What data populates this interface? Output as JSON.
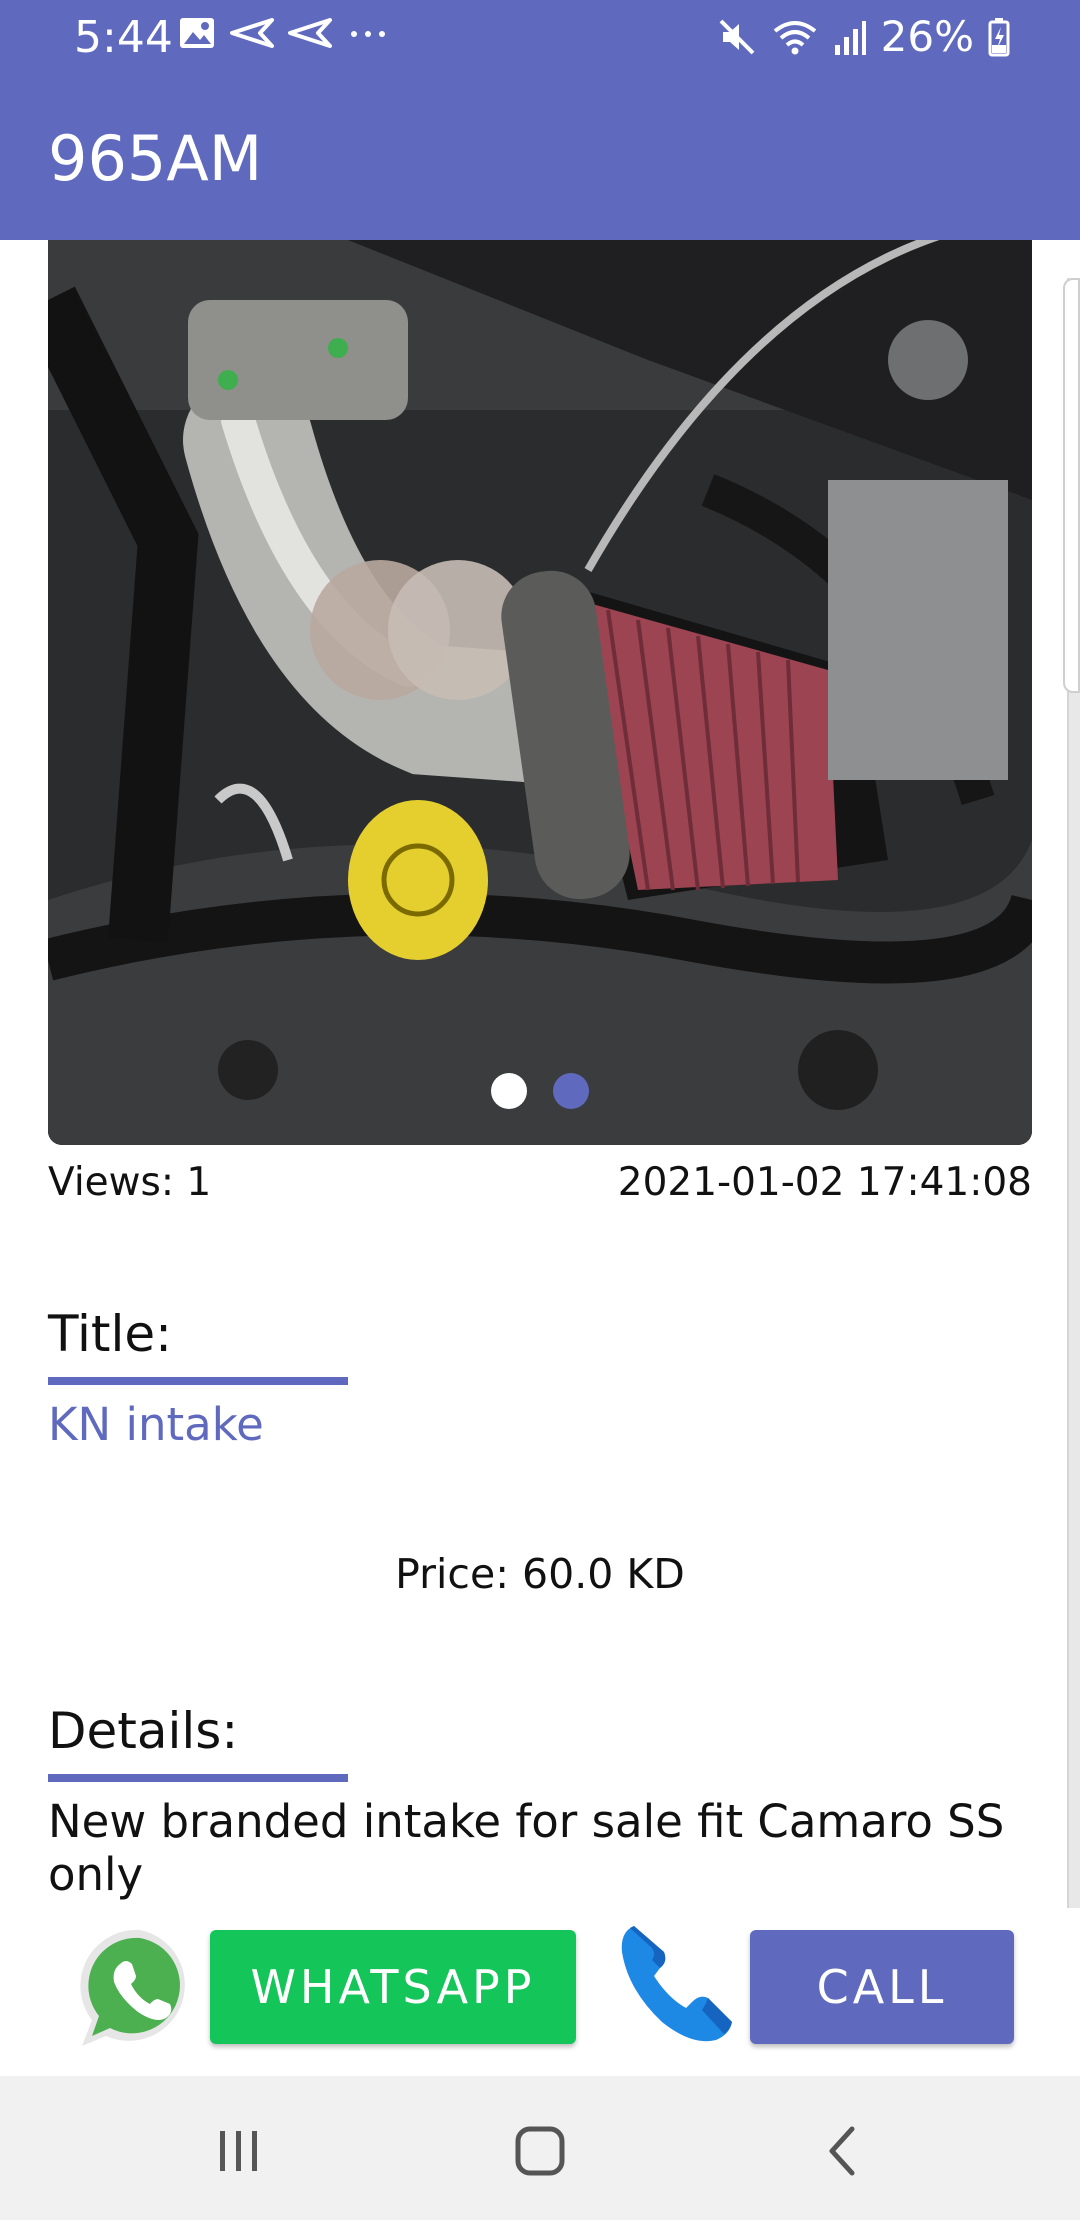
{
  "status_bar": {
    "time": "5:44",
    "battery": "26%",
    "left_icons": [
      "gallery-icon",
      "send-icon",
      "send-icon",
      "more-dots-icon"
    ],
    "right_icons": [
      "mute-icon",
      "wifi-icon",
      "signal-icon",
      "battery-icon"
    ]
  },
  "app_bar": {
    "title": "965AM"
  },
  "slider": {
    "image": "car-engine-air-intake-photo",
    "dots_count": 2,
    "active_index": 1,
    "colors": {
      "inactive": "#ffffff",
      "active": "#5f6abf"
    }
  },
  "listing": {
    "views": "Views: 1",
    "date": "2021-01-02 17:41:08",
    "title_label": "Title:",
    "title_value": "KN intake",
    "price": "Price: 60.0 KD",
    "details_label": "Details:",
    "details_value": "New branded intake for sale fit Camaro SS only"
  },
  "actions": {
    "whatsapp_label": "WHATSAPP",
    "call_label": "CALL",
    "whatsapp_icon": "whatsapp-icon",
    "phone_icon": "phone-icon"
  },
  "nav_bar": {
    "icons": [
      "recent-apps-icon",
      "home-icon",
      "back-icon"
    ]
  },
  "colors": {
    "primary": "#5f6abf",
    "whatsapp_green": "#14c55a",
    "phone_blue": "#1e88e5"
  }
}
